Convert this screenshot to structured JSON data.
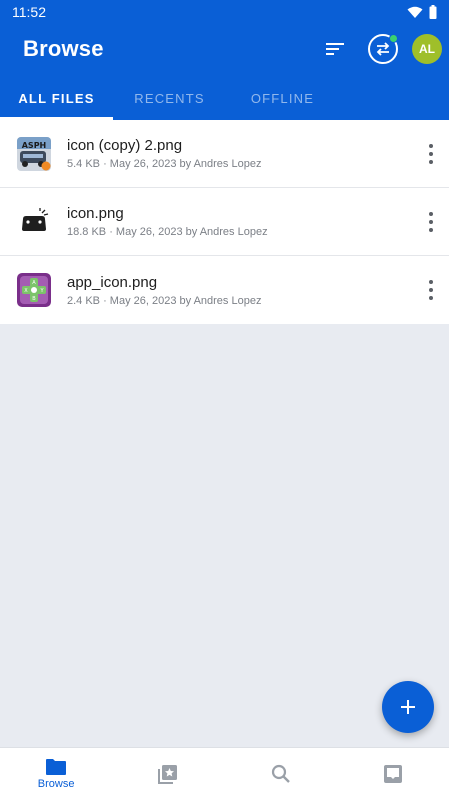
{
  "status_bar": {
    "time": "11:52"
  },
  "header": {
    "title": "Browse",
    "avatar_initials": "AL"
  },
  "tabs": [
    {
      "label": "ALL FILES",
      "active": true
    },
    {
      "label": "RECENTS",
      "active": false
    },
    {
      "label": "OFFLINE",
      "active": false
    }
  ],
  "files": [
    {
      "name": "icon (copy) 2.png",
      "meta": "5.4 KB · May 26, 2023 by Andres Lopez"
    },
    {
      "name": "icon.png",
      "meta": "18.8 KB · May 26, 2023 by Andres Lopez"
    },
    {
      "name": "app_icon.png",
      "meta": "2.4 KB · May 26, 2023 by Andres Lopez"
    }
  ],
  "bottom_nav": [
    {
      "label": "Browse",
      "icon": "folder-icon",
      "active": true
    },
    {
      "icon": "starred-photos-icon"
    },
    {
      "icon": "search-icon"
    },
    {
      "icon": "inbox-icon"
    }
  ],
  "colors": {
    "primary": "#0a5fd6",
    "background": "#e8ebf1",
    "avatar": "#9fbf2a"
  }
}
